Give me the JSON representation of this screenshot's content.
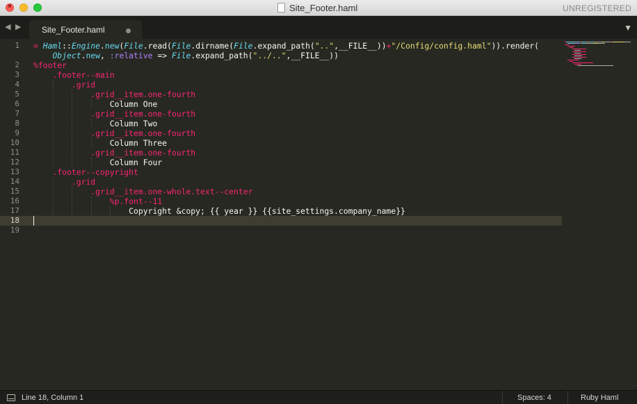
{
  "window": {
    "title": "Site_Footer.haml",
    "license_notice": "UNREGISTERED"
  },
  "tabs": [
    {
      "label": "Site_Footer.haml",
      "modified": true
    }
  ],
  "editor": {
    "active_line": 18,
    "line_numbers": [
      "1",
      "",
      "2",
      "3",
      "4",
      "5",
      "6",
      "7",
      "8",
      "9",
      "10",
      "11",
      "12",
      "13",
      "14",
      "15",
      "16",
      "17",
      "18",
      "19"
    ],
    "lines": [
      [
        {
          "c": "t-op",
          "t": "= "
        },
        {
          "c": "t-class",
          "t": "Haml"
        },
        {
          "c": "t-text",
          "t": "::"
        },
        {
          "c": "t-class",
          "t": "Engine"
        },
        {
          "c": "t-text",
          "t": "."
        },
        {
          "c": "t-fn",
          "t": "new"
        },
        {
          "c": "t-text",
          "t": "("
        },
        {
          "c": "t-class",
          "t": "File"
        },
        {
          "c": "t-text",
          "t": ".read("
        },
        {
          "c": "t-class",
          "t": "File"
        },
        {
          "c": "t-text",
          "t": ".dirname("
        },
        {
          "c": "t-class",
          "t": "File"
        },
        {
          "c": "t-text",
          "t": ".expand_path("
        },
        {
          "c": "t-str",
          "t": "\"..\""
        },
        {
          "c": "t-text",
          "t": ",__FILE__))"
        },
        {
          "c": "t-op",
          "t": "+"
        },
        {
          "c": "t-str",
          "t": "\"/Config/config.haml\""
        },
        {
          "c": "t-text",
          "t": ")).render("
        }
      ],
      [
        {
          "c": "t-text",
          "t": "    "
        },
        {
          "c": "t-class",
          "t": "Object"
        },
        {
          "c": "t-text",
          "t": "."
        },
        {
          "c": "t-fn",
          "t": "new"
        },
        {
          "c": "t-text",
          "t": ", "
        },
        {
          "c": "t-sym",
          "t": ":relative"
        },
        {
          "c": "t-text",
          "t": " => "
        },
        {
          "c": "t-class",
          "t": "File"
        },
        {
          "c": "t-text",
          "t": ".expand_path("
        },
        {
          "c": "t-str",
          "t": "\"../..\""
        },
        {
          "c": "t-text",
          "t": ",__FILE__))"
        }
      ],
      [
        {
          "c": "t-tag",
          "t": "%footer"
        }
      ],
      [
        {
          "c": "t-text",
          "t": "    "
        },
        {
          "c": "t-tag",
          "t": ".footer--main"
        }
      ],
      [
        {
          "c": "t-text",
          "t": "        "
        },
        {
          "c": "t-tag",
          "t": ".grid"
        }
      ],
      [
        {
          "c": "t-text",
          "t": "            "
        },
        {
          "c": "t-tag",
          "t": ".grid__item.one-fourth"
        }
      ],
      [
        {
          "c": "t-text",
          "t": "                Column One"
        }
      ],
      [
        {
          "c": "t-text",
          "t": "            "
        },
        {
          "c": "t-tag",
          "t": ".grid__item.one-fourth"
        }
      ],
      [
        {
          "c": "t-text",
          "t": "                Column Two"
        }
      ],
      [
        {
          "c": "t-text",
          "t": "            "
        },
        {
          "c": "t-tag",
          "t": ".grid__item.one-fourth"
        }
      ],
      [
        {
          "c": "t-text",
          "t": "                Column Three"
        }
      ],
      [
        {
          "c": "t-text",
          "t": "            "
        },
        {
          "c": "t-tag",
          "t": ".grid__item.one-fourth"
        }
      ],
      [
        {
          "c": "t-text",
          "t": "                Column Four"
        }
      ],
      [
        {
          "c": "t-text",
          "t": "    "
        },
        {
          "c": "t-tag",
          "t": ".footer--copyright"
        }
      ],
      [
        {
          "c": "t-text",
          "t": "        "
        },
        {
          "c": "t-tag",
          "t": ".grid"
        }
      ],
      [
        {
          "c": "t-text",
          "t": "            "
        },
        {
          "c": "t-tag",
          "t": ".grid__item.one-whole.text--center"
        }
      ],
      [
        {
          "c": "t-text",
          "t": "                "
        },
        {
          "c": "t-tag",
          "t": "%p.font--11"
        }
      ],
      [
        {
          "c": "t-text",
          "t": "                    Copyright &copy; {{ year }} {{site_settings.company_name}}"
        }
      ],
      [
        {
          "c": "t-text",
          "t": ""
        }
      ],
      [
        {
          "c": "t-text",
          "t": ""
        }
      ]
    ]
  },
  "statusbar": {
    "position": "Line 18, Column 1",
    "indentation": "Spaces: 4",
    "syntax": "Ruby Haml"
  },
  "colors": {
    "background": "#272822",
    "keyword": "#f92672",
    "class": "#66d9ef",
    "string": "#e6db74",
    "symbol": "#ae81ff",
    "text": "#f8f8f2"
  }
}
